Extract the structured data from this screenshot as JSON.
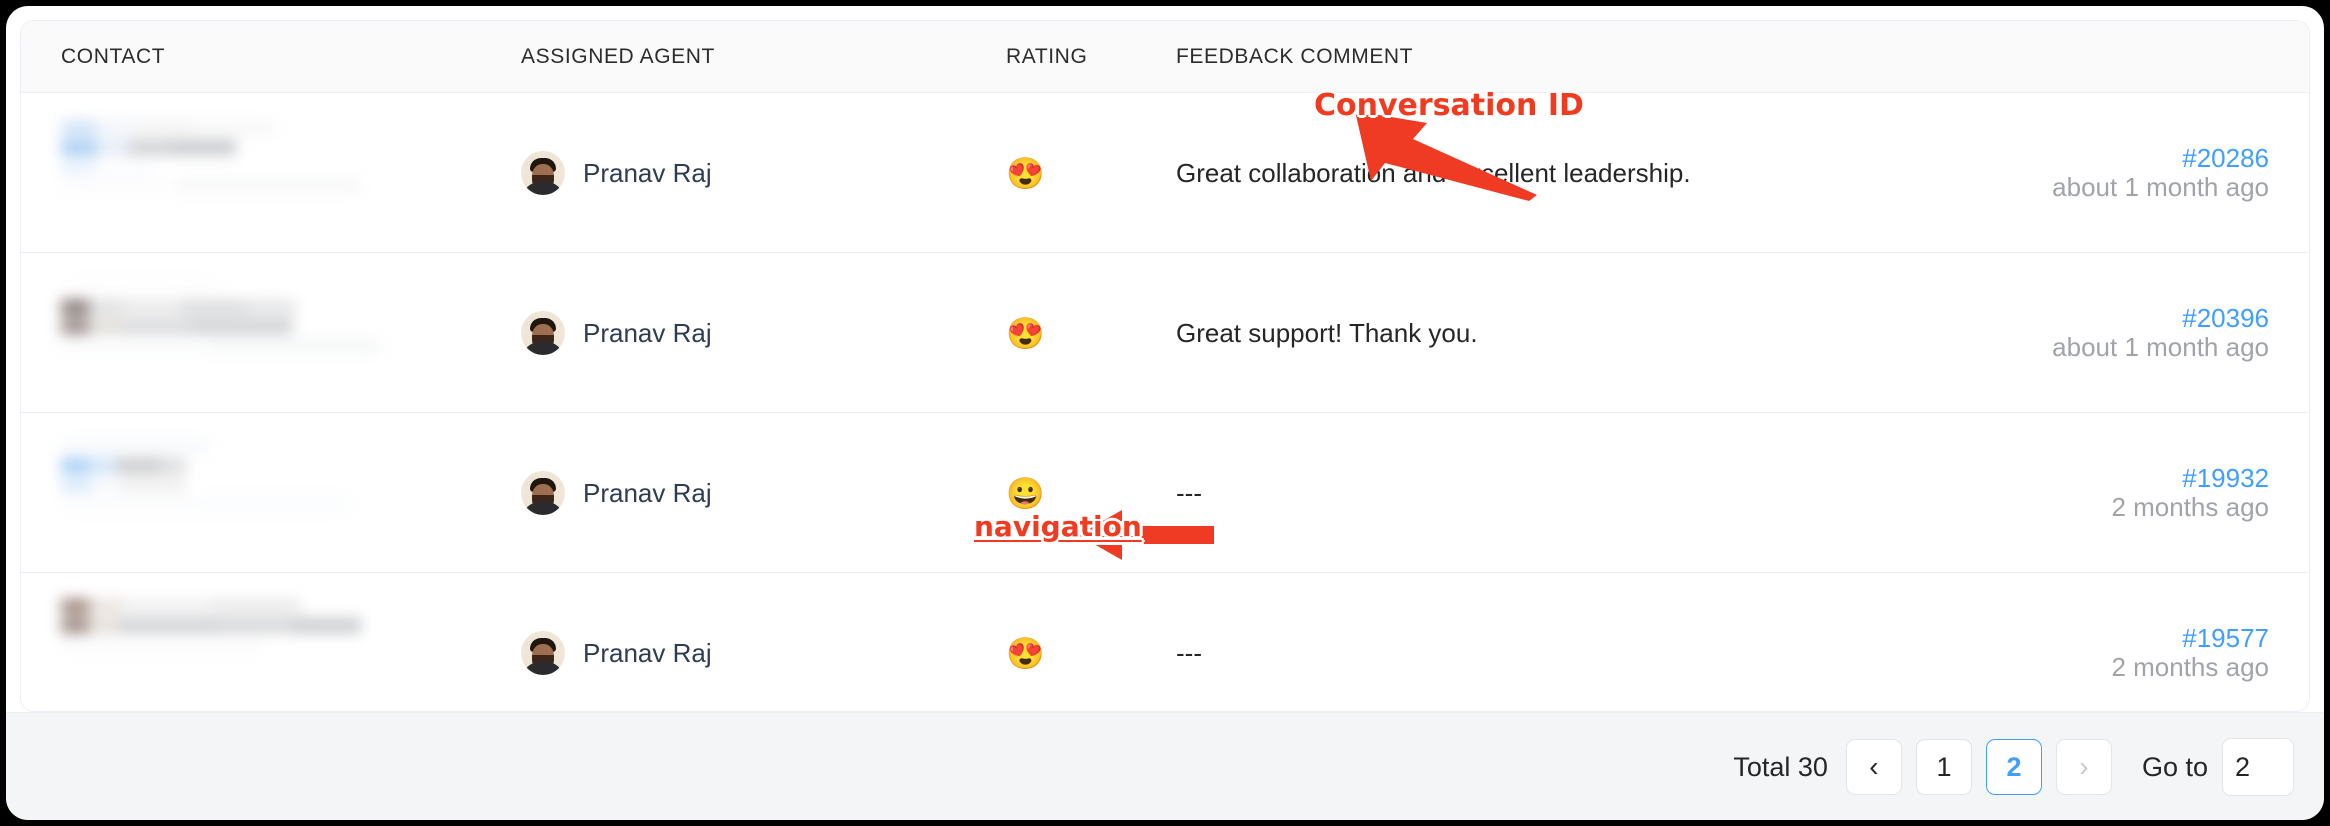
{
  "table": {
    "columns": [
      {
        "key": "contact",
        "label": "CONTACT"
      },
      {
        "key": "agent",
        "label": "ASSIGNED AGENT"
      },
      {
        "key": "rating",
        "label": "RATING"
      },
      {
        "key": "comment",
        "label": "FEEDBACK COMMENT"
      },
      {
        "key": "conv_id",
        "label": ""
      }
    ],
    "rows": [
      {
        "contact": "",
        "agent": "Pranav Raj",
        "agent_avatar": "agent-photo-avatar",
        "rating_emoji": "😍",
        "rating_name": "smiling-face-with-heart-eyes",
        "comment": "Great collaboration and excellent leadership.",
        "conversation_id": "#20286",
        "time_ago": "about 1 month ago"
      },
      {
        "contact": "",
        "agent": "Pranav Raj",
        "agent_avatar": "agent-photo-avatar",
        "rating_emoji": "😍",
        "rating_name": "smiling-face-with-heart-eyes",
        "comment": "Great support! Thank you.",
        "conversation_id": "#20396",
        "time_ago": "about 1 month ago"
      },
      {
        "contact": "",
        "agent": "Pranav Raj",
        "agent_avatar": "agent-photo-avatar",
        "rating_emoji": "😀",
        "rating_name": "grinning-face",
        "comment": "---",
        "conversation_id": "#19932",
        "time_ago": "2 months ago"
      },
      {
        "contact": "",
        "agent": "Pranav Raj",
        "agent_avatar": "agent-photo-avatar",
        "rating_emoji": "😍",
        "rating_name": "smiling-face-with-heart-eyes",
        "comment": "---",
        "conversation_id": "#19577",
        "time_ago": "2 months ago"
      }
    ]
  },
  "footer": {
    "total_label": "Total 30",
    "prev_icon": "‹",
    "next_icon": "›",
    "pages": [
      "1",
      "2"
    ],
    "active_page": "2",
    "next_disabled": true,
    "goto_label": "Go to",
    "goto_value": "2"
  },
  "annotations": [
    {
      "id": "conversation-id",
      "text": "Conversation ID",
      "arrow": "arrow-up-left"
    },
    {
      "id": "navigation",
      "text": "navigation",
      "arrow": "arrow-left"
    }
  ],
  "colors": {
    "link_blue": "#409eff",
    "annotation_red": "#f03b20",
    "header_bg": "#fafafa",
    "footer_bg": "#f4f5f7",
    "border": "#ebeef5",
    "muted_text": "#a0a3a8"
  }
}
